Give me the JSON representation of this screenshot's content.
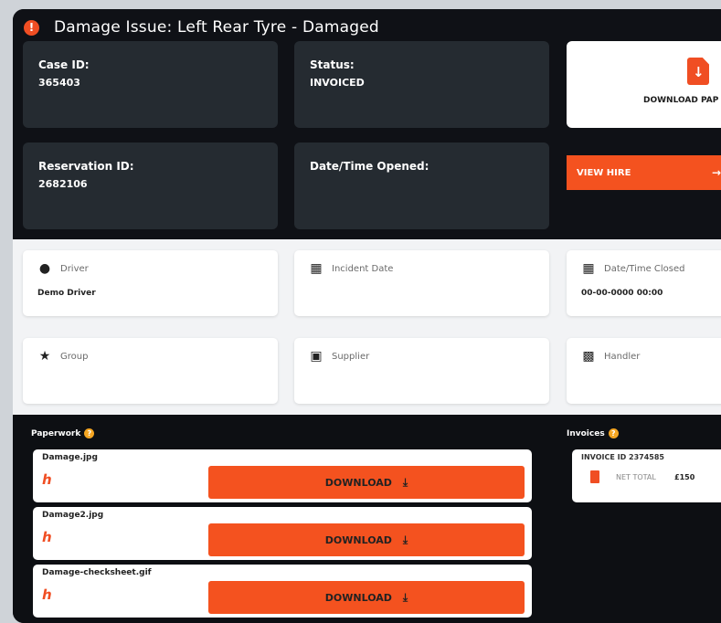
{
  "header": {
    "title": "Damage Issue: Left Rear Tyre - Damaged",
    "alert_icon": "alert-icon"
  },
  "info_cards": {
    "case_id_label": "Case ID:",
    "case_id_value": "365403",
    "status_label": "Status:",
    "status_value": "INVOICED",
    "reservation_label": "Reservation ID:",
    "reservation_value": "2682106",
    "opened_label": "Date/Time Opened:",
    "opened_value": ""
  },
  "actions": {
    "download_papers_label": "DOWNLOAD PAP",
    "view_hire_label": "VIEW HIRE",
    "view_hire_arrow": "→"
  },
  "details": {
    "driver_label": "Driver",
    "driver_value": "Demo Driver",
    "incident_label": "Incident Date",
    "incident_value": "",
    "closed_label": "Date/Time Closed",
    "closed_value": "00-00-0000 00:00",
    "group_label": "Group",
    "supplier_label": "Supplier",
    "handler_label": "Handler"
  },
  "paperwork": {
    "title": "Paperwork",
    "items": [
      {
        "filename": "Damage.jpg",
        "button": "DOWNLOAD"
      },
      {
        "filename": "Damage2.jpg",
        "button": "DOWNLOAD"
      },
      {
        "filename": "Damage-checksheet.gif",
        "button": "DOWNLOAD"
      }
    ]
  },
  "invoices": {
    "title": "Invoices",
    "items": [
      {
        "id": "INVOICE ID 2374585",
        "net_label": "NET TOTAL",
        "net_value": "£150"
      }
    ]
  },
  "colors": {
    "accent": "#f4521f",
    "dark_bg": "#0f1116",
    "card_bg": "#252b31",
    "light_bg": "#f2f3f5"
  }
}
